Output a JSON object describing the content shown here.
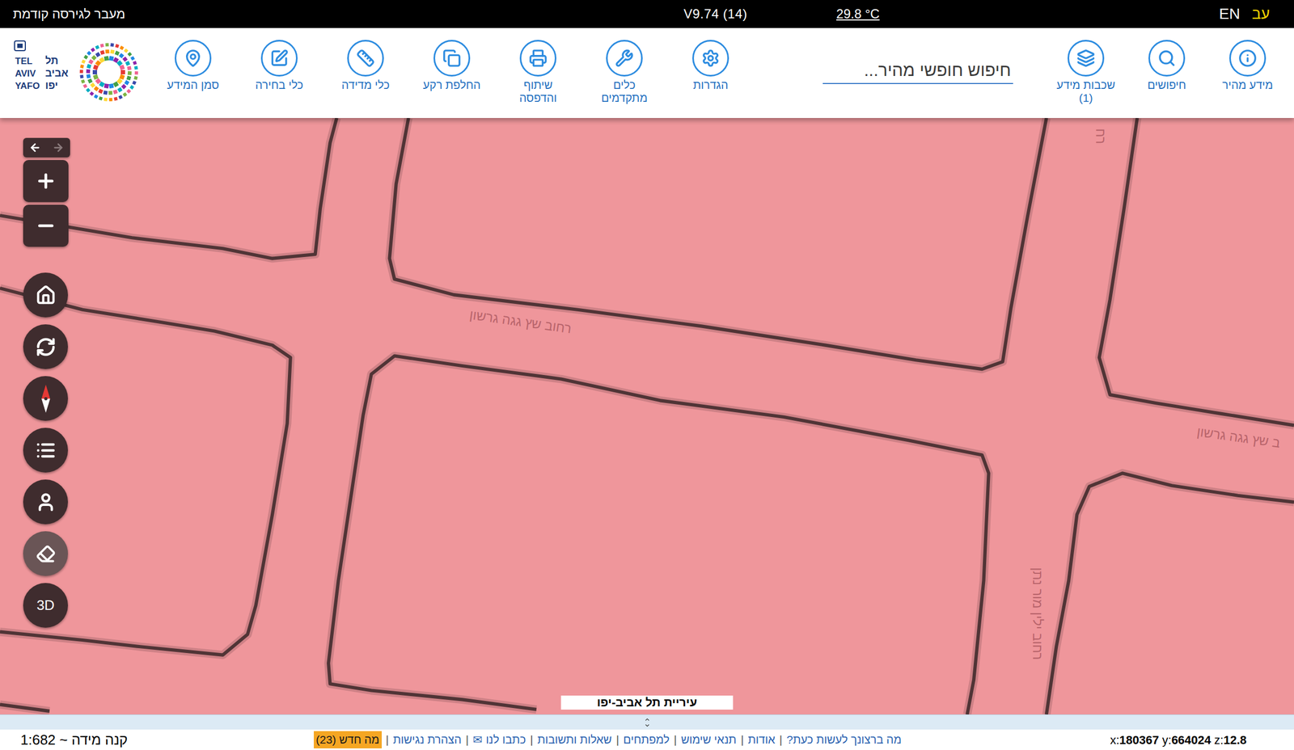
{
  "top_bar": {
    "previous_version": "מעבר לגירסה קודמת",
    "version": "V9.74 (14)",
    "temperature": "29.8 °C",
    "languages": [
      {
        "label": "EN",
        "selected": false
      },
      {
        "label": "עב",
        "selected": true
      }
    ]
  },
  "logo": {
    "rows": [
      {
        "en": "TEL",
        "he": "תל"
      },
      {
        "en": "AVIV",
        "he": "אביב"
      },
      {
        "en": "YAFO",
        "he": "יפו"
      }
    ]
  },
  "toolbar": {
    "right_items": [
      {
        "lines": [
          "מידע מהיר"
        ]
      },
      {
        "lines": [
          "חיפושים"
        ]
      },
      {
        "lines": [
          "שכבות מידע"
        ],
        "count": "(1)"
      }
    ],
    "search": {
      "placeholder": "חיפוש חופשי מהיר..."
    },
    "tools": [
      {
        "lines": [
          "הגדרות"
        ]
      },
      {
        "lines": [
          "כלים",
          "מתקדמים"
        ]
      },
      {
        "lines": [
          "שיתוף",
          "והדפסה"
        ]
      },
      {
        "lines": [
          "החלפת רקע"
        ]
      },
      {
        "lines": [
          "כלי מדידה"
        ]
      },
      {
        "lines": [
          "כלי בחירה"
        ]
      },
      {
        "lines": [
          "סמן המידע"
        ]
      }
    ]
  },
  "map": {
    "controls": {
      "history": {
        "back_enabled": true,
        "forward_enabled": false
      },
      "eraser": {
        "disabled": true
      },
      "view_3d": {
        "label": "3D"
      }
    },
    "street_labels": [
      {
        "text": "רחוב שץ גגה גרשון"
      },
      {
        "text": "רחוב ילין מור נתן"
      },
      {
        "text": "ב שץ גגה גרשון"
      },
      {
        "text": "רח"
      }
    ],
    "attribution": "עיריית תל אביב-יפו"
  },
  "footer": {
    "scale": "קנה מידה ~ 1:682",
    "separator": "|",
    "links": [
      {
        "label": "מה ברצונך לעשות כעת?",
        "highlighted": false
      },
      {
        "label": "אודות",
        "highlighted": false
      },
      {
        "label": "תנאי שימוש",
        "highlighted": false
      },
      {
        "label": "למפתחים",
        "highlighted": false
      },
      {
        "label": "שאלות ותשובות",
        "highlighted": false
      },
      {
        "label": "כתבו לנו ✉",
        "highlighted": false
      },
      {
        "label": "הצהרת נגישות",
        "highlighted": false
      },
      {
        "label": "מה חדש (23)",
        "highlighted": true
      }
    ],
    "coordinates": [
      {
        "label": "x:",
        "value": "180367"
      },
      {
        "label": "y:",
        "value": "664024"
      },
      {
        "label": "z:",
        "value": "12.8"
      }
    ]
  }
}
